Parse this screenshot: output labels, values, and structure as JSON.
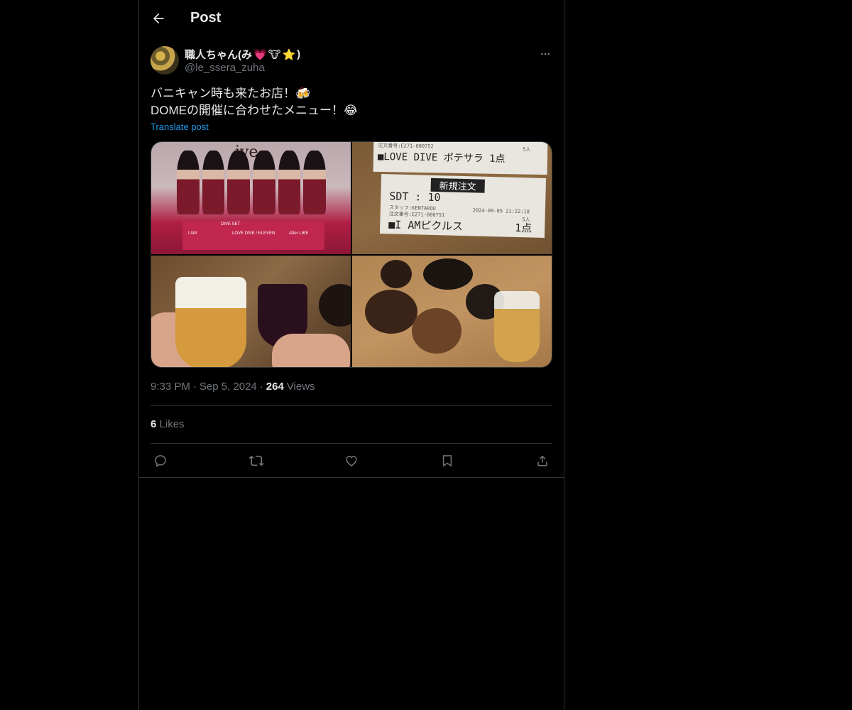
{
  "header": {
    "title": "Post",
    "back_icon": "arrow-left-icon"
  },
  "author": {
    "display_name": "職人ちゃん(み",
    "name_emojis": [
      "💗",
      "🐮",
      "⭐"
    ],
    "name_suffix": ")",
    "handle": "@le_ssera_zuha"
  },
  "post": {
    "line1": "バニキャン時も来たお店！",
    "line1_emoji": "🍻",
    "line2": "DOMEの開催に合わせたメニュー！",
    "line2_emoji": "😂",
    "translate_label": "Translate post"
  },
  "media": {
    "photo1": {
      "poster_logo": "ive",
      "poster_title": "DIVE SET",
      "poster_items": [
        "I AM",
        "LOVE DIVE / ELEVEN",
        "After LIKE"
      ]
    },
    "photo2": {
      "receipt1": {
        "header": "注文番号:E271-000752",
        "item": "■LOVE DIVE ポテサラ 1点",
        "count": "5人"
      },
      "receipt2": {
        "band": "新規注文",
        "table": "SDT : 10",
        "staff": "スタッフ:KENTAROU",
        "order": "注文番号:E271-000751",
        "datetime": "2024-09-05 21:22:18",
        "item": "■I AMピクルス",
        "qty": "1点",
        "count": "5人"
      }
    }
  },
  "meta": {
    "time": "9:33 PM",
    "date": "Sep 5, 2024",
    "views_count": "264",
    "views_label": "Views",
    "sep": "·"
  },
  "likes": {
    "count": "6",
    "label": "Likes"
  },
  "colors": {
    "background": "#000000",
    "border": "#2f3336",
    "text": "#e7e9ea",
    "muted": "#71767b",
    "link": "#1d9bf0"
  },
  "actions": [
    "reply-icon",
    "repost-icon",
    "like-icon",
    "bookmark-icon",
    "share-icon"
  ]
}
